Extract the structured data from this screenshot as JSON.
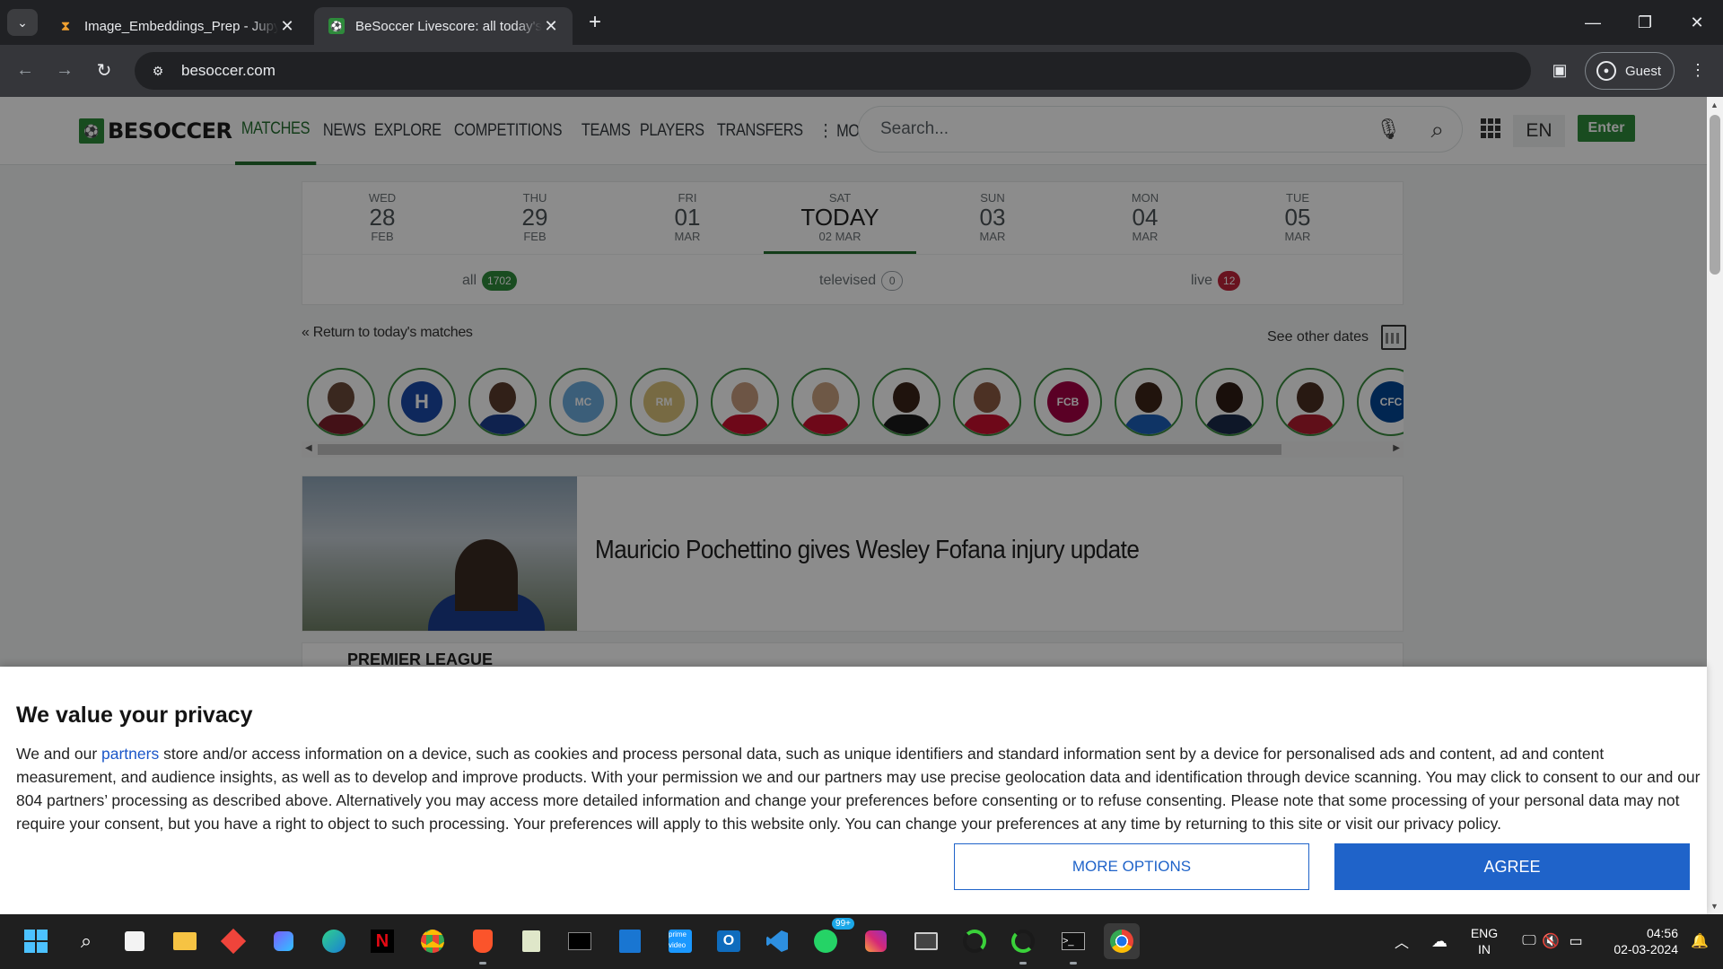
{
  "browser": {
    "tabs": [
      {
        "title": "Image_Embeddings_Prep - Jupyter",
        "favicon": "hourglass-icon",
        "active": false
      },
      {
        "title": "BeSoccer Livescore: all today's live",
        "favicon": "besoccer-icon",
        "active": true
      }
    ],
    "url": "besoccer.com",
    "profile_label": "Guest"
  },
  "site": {
    "logo_text": "BESOCCER",
    "nav": [
      {
        "label": "MATCHES",
        "active": true
      },
      {
        "label": "NEWS",
        "active": false
      },
      {
        "label": "EXPLORE",
        "active": false
      },
      {
        "label": "COMPETITIONS",
        "active": false
      },
      {
        "label": "TEAMS",
        "active": false
      },
      {
        "label": "PLAYERS",
        "active": false
      },
      {
        "label": "TRANSFERS",
        "active": false
      },
      {
        "label": "⋮ MORE",
        "active": false
      }
    ],
    "search_placeholder": "Search...",
    "language": "EN",
    "enter_label": "Enter"
  },
  "dates": [
    {
      "dow": "WED",
      "num": "28",
      "mon": "FEB"
    },
    {
      "dow": "THU",
      "num": "29",
      "mon": "FEB"
    },
    {
      "dow": "FRI",
      "num": "01",
      "mon": "MAR"
    },
    {
      "dow": "SAT",
      "num": "TODAY",
      "mon": "02 MAR",
      "today": true
    },
    {
      "dow": "SUN",
      "num": "03",
      "mon": "MAR"
    },
    {
      "dow": "MON",
      "num": "04",
      "mon": "MAR"
    },
    {
      "dow": "TUE",
      "num": "05",
      "mon": "MAR"
    }
  ],
  "filters": {
    "all": {
      "label": "all",
      "count": "1702"
    },
    "televised": {
      "label": "televised",
      "count": "0"
    },
    "live": {
      "label": "live",
      "count": "12"
    }
  },
  "links": {
    "return": "« Return to today's matches",
    "other_dates": "See other dates"
  },
  "featured": [
    {
      "type": "player",
      "skin": "#6b4a3a",
      "kit": "#7a1f2b"
    },
    {
      "type": "crest",
      "bg": "#1a4aa8",
      "glyph": "H"
    },
    {
      "type": "player",
      "skin": "#5a3b2c",
      "kit": "#1c3f8f"
    },
    {
      "type": "crest",
      "bg": "#6cabdd",
      "glyph": "MC"
    },
    {
      "type": "crest",
      "bg": "#d9c27a",
      "glyph": "RM"
    },
    {
      "type": "player",
      "skin": "#c69c7e",
      "kit": "#c8102e"
    },
    {
      "type": "player",
      "skin": "#c9a080",
      "kit": "#c8102e"
    },
    {
      "type": "player",
      "skin": "#3a2418",
      "kit": "#1a1a1a"
    },
    {
      "type": "player",
      "skin": "#8a5a42",
      "kit": "#c8102e"
    },
    {
      "type": "crest",
      "bg": "#a50044",
      "glyph": "FCB"
    },
    {
      "type": "player",
      "skin": "#3d2619",
      "kit": "#1c5fb8"
    },
    {
      "type": "player",
      "skin": "#2e1c14",
      "kit": "#1b2a4a"
    },
    {
      "type": "player",
      "skin": "#4a2e22",
      "kit": "#b01c2e"
    },
    {
      "type": "crest",
      "bg": "#034694",
      "glyph": "CFC"
    }
  ],
  "news": {
    "headline": "Mauricio Pochettino gives Wesley Fofana injury update"
  },
  "league_strip": "PREMIER LEAGUE",
  "consent": {
    "title": "We value your privacy",
    "text_before_link": "We and our ",
    "link_text": "partners",
    "text_after_link": " store and/or access information on a device, such as cookies and process personal data, such as unique identifiers and standard information sent by a device for personalised ads and content, ad and content measurement, and audience insights, as well as to develop and improve products. With your permission we and our partners may use precise geolocation data and identification through device scanning. You may click to consent to our and our 804 partners’ processing as described above. Alternatively you may access more detailed information and change your preferences before consenting or to refuse consenting. Please note that some processing of your personal data may not require your consent, but you have a right to object to such processing. Your preferences will apply to this website only. You can change your preferences at any time by returning to this site or visit our privacy policy.",
    "more_options": "MORE OPTIONS",
    "agree": "AGREE"
  },
  "taskbar": {
    "whatsapp_badge": "99+",
    "lang_line1": "ENG",
    "lang_line2": "IN",
    "time": "04:56",
    "date": "02-03-2024"
  }
}
